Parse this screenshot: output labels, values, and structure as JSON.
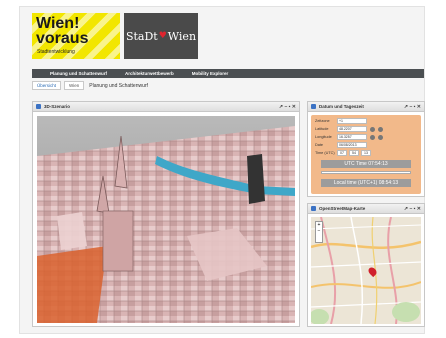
{
  "header": {
    "logo_wien_line1": "Wien!",
    "logo_wien_line2": "voraus",
    "logo_wien_sub": "Stadtentwicklung",
    "logo_stadt_a": "StaDt",
    "logo_stadt_heart": "♥",
    "logo_stadt_b": "Wien"
  },
  "nav": {
    "items": [
      "Planung und Schattenwurf",
      "Architekturwettbewerb",
      "Mobility Explorer"
    ]
  },
  "breadcrumb": {
    "crumbs": [
      "Übersicht",
      "Wien"
    ],
    "current": "Planung und Schattenwurf"
  },
  "panel_3d": {
    "title": "3D-Szenario",
    "controls": "↗ – ▪ ✕"
  },
  "panel_date": {
    "title": "Datum und Tageszeit",
    "controls": "↗ – ▪ ✕",
    "labels": [
      "Zeitzone",
      "Latitude",
      "Longitude",
      "Date",
      "Time (UTC)"
    ],
    "values": [
      "+1",
      "48.2207",
      "16.3257",
      "06/08/2013",
      ""
    ],
    "time_h": "07",
    "time_m": "54",
    "time_s": "13",
    "utc_time": "UTC Time 07:54:13",
    "local_time": "Local time (UTC+1) 08:54:13",
    "slider_position": 0.33
  },
  "panel_map": {
    "title": "OpenStreetMap-Karte",
    "controls": "↗ – ▪ ✕",
    "zoom_in": "+",
    "zoom_out": "−"
  }
}
